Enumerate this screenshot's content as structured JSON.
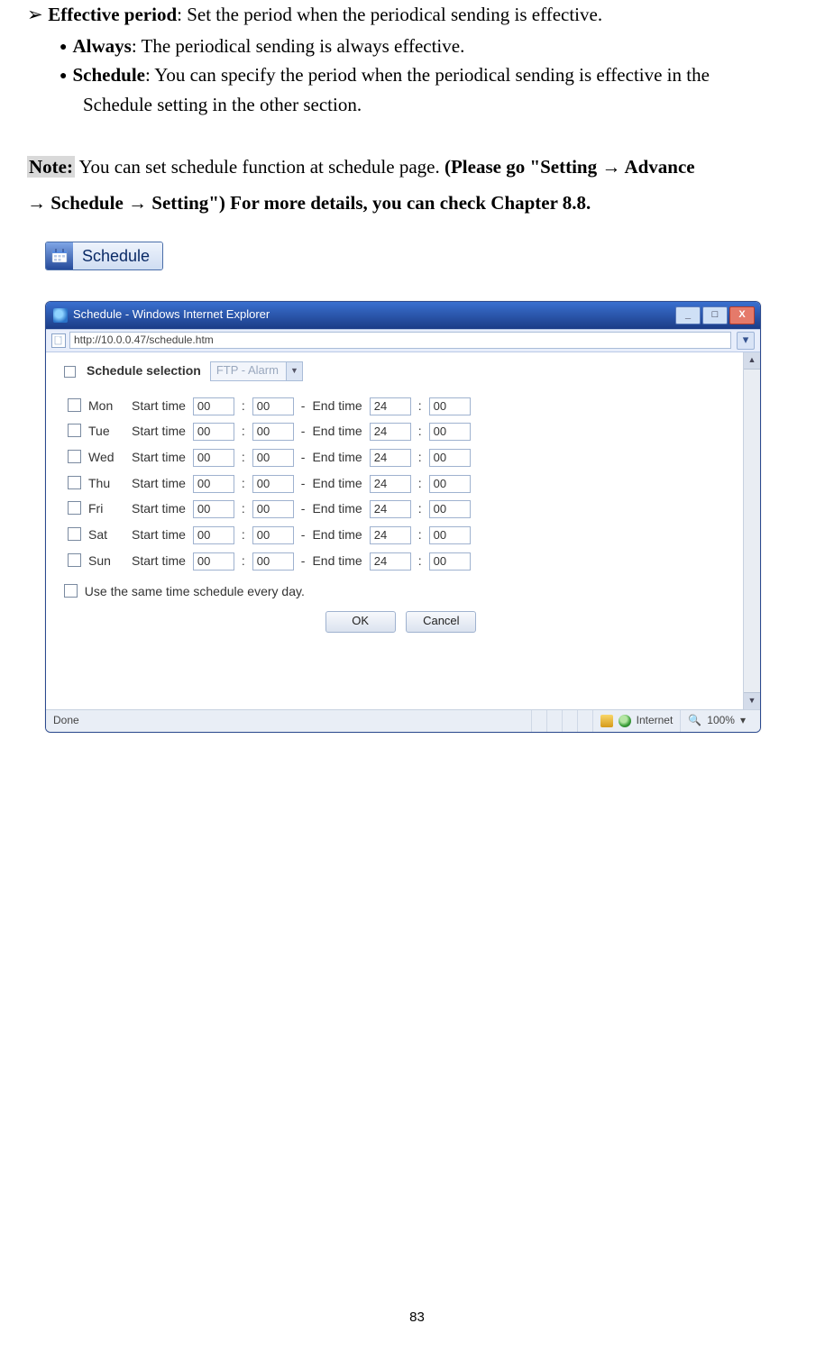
{
  "doc": {
    "effective_period_label": "Effective period",
    "effective_period_text": ": Set the period when the periodical sending is effective.",
    "always_label": "Always",
    "always_text": ": The periodical sending is always effective.",
    "schedule_label": "Schedule",
    "schedule_text_1": ": You can specify the period when the periodical sending is effective in the",
    "schedule_text_2": "Schedule setting in the other section.",
    "note_label": "Note:",
    "note_text_1": " You can set schedule function at schedule page. ",
    "note_bold_1": "(Please go \"Setting → Advance",
    "note_bold_2": "→ Schedule → Setting\") For more details, you can check Chapter 8.8.",
    "page_number": "83"
  },
  "schedule_button": {
    "label": "Schedule"
  },
  "ie_window": {
    "title": "Schedule - Windows Internet Explorer",
    "url": "http://10.0.0.47/schedule.htm",
    "section_title": "Schedule selection",
    "dropdown_value": "FTP - Alarm",
    "start_label": "Start time",
    "end_label": "End time",
    "colon": ":",
    "dash": "-",
    "same_time_label": "Use the same time schedule every day.",
    "ok_label": "OK",
    "cancel_label": "Cancel",
    "status_done": "Done",
    "status_zone": "Internet",
    "status_zoom": "100%",
    "min_btn": "_",
    "max_btn": "□",
    "close_btn": "X",
    "up_arrow": "▲",
    "down_arrow": "▼",
    "dd_arrow": "▼",
    "go_arrow": "▾",
    "zoom_arrow": "▾",
    "rows": [
      {
        "day": "Mon",
        "sh": "00",
        "sm": "00",
        "eh": "24",
        "em": "00"
      },
      {
        "day": "Tue",
        "sh": "00",
        "sm": "00",
        "eh": "24",
        "em": "00"
      },
      {
        "day": "Wed",
        "sh": "00",
        "sm": "00",
        "eh": "24",
        "em": "00"
      },
      {
        "day": "Thu",
        "sh": "00",
        "sm": "00",
        "eh": "24",
        "em": "00"
      },
      {
        "day": "Fri",
        "sh": "00",
        "sm": "00",
        "eh": "24",
        "em": "00"
      },
      {
        "day": "Sat",
        "sh": "00",
        "sm": "00",
        "eh": "24",
        "em": "00"
      },
      {
        "day": "Sun",
        "sh": "00",
        "sm": "00",
        "eh": "24",
        "em": "00"
      }
    ]
  }
}
